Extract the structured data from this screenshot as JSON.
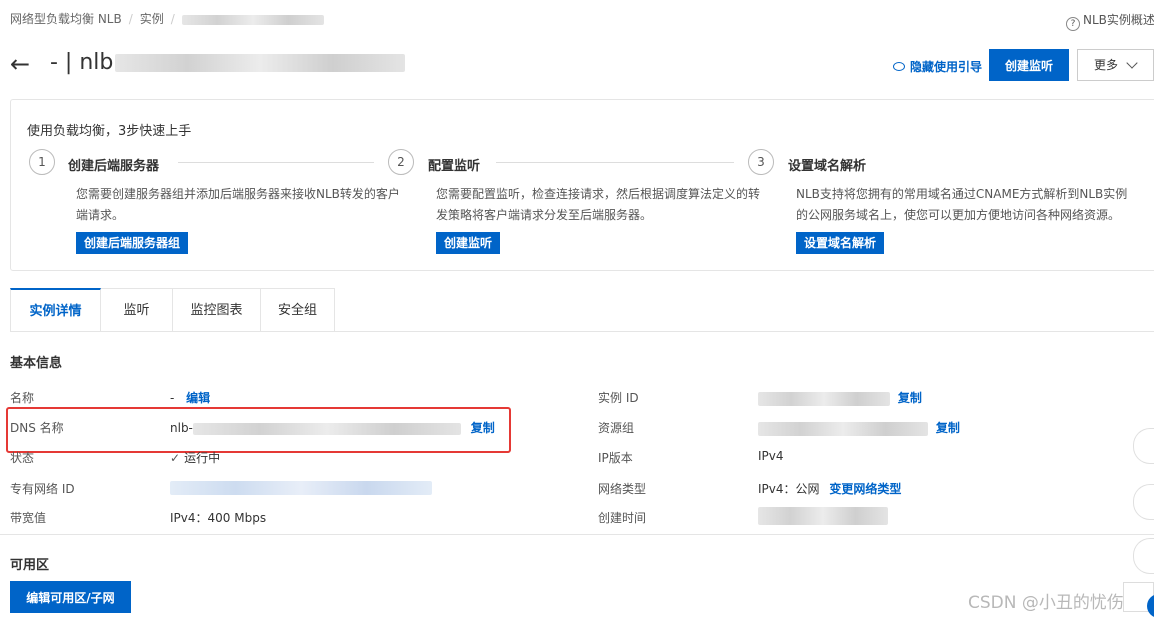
{
  "breadcrumb": {
    "items": [
      "网络型负载均衡 NLB",
      "实例"
    ]
  },
  "help": {
    "icon": "?",
    "label": "NLB实例概述"
  },
  "header": {
    "back": "←",
    "title_prefix": "- | nlb",
    "guide_label": "隐藏使用引导",
    "create_button": "创建监听",
    "more_button": "更多"
  },
  "guide": {
    "title": "使用负载均衡，3步快速上手",
    "steps": [
      {
        "number": "1",
        "title": "创建后端服务器",
        "desc": "您需要创建服务器组并添加后端服务器来接收NLB转发的客户端请求。",
        "button": "创建后端服务器组"
      },
      {
        "number": "2",
        "title": "配置监听",
        "desc": "您需要配置监听，检查连接请求，然后根据调度算法定义的转发策略将客户端请求分发至后端服务器。",
        "button": "创建监听"
      },
      {
        "number": "3",
        "title": "设置域名解析",
        "desc": "NLB支持将您拥有的常用域名通过CNAME方式解析到NLB实例的公网服务域名上，使您可以更加方便地访问各种网络资源。",
        "button": "设置域名解析"
      }
    ]
  },
  "tabs": [
    "实例详情",
    "监听",
    "监控图表",
    "安全组"
  ],
  "basic_info": {
    "title": "基本信息",
    "name_label": "名称",
    "name_value": "-",
    "edit_link": "编辑",
    "dns_label": "DNS 名称",
    "dns_value_prefix": "nlb-",
    "copy_link": "复制",
    "status_label": "状态",
    "status_value": "运行中",
    "vpc_label": "专有网络 ID",
    "bandwidth_label": "带宽值",
    "bandwidth_value": "IPv4：400 Mbps",
    "instance_id_label": "实例 ID",
    "resource_group_label": "资源组",
    "ip_version_label": "IP版本",
    "ip_version_value": "IPv4",
    "network_type_label": "网络类型",
    "network_type_value": "IPv4：公网",
    "change_network_link": "变更网络类型",
    "created_label": "创建时间"
  },
  "zones": {
    "title": "可用区",
    "edit_button": "编辑可用区/子网"
  },
  "watermark": "CSDN @小丑的忧伤",
  "colors": {
    "primary": "#0064c8",
    "highlight": "#e53935"
  }
}
